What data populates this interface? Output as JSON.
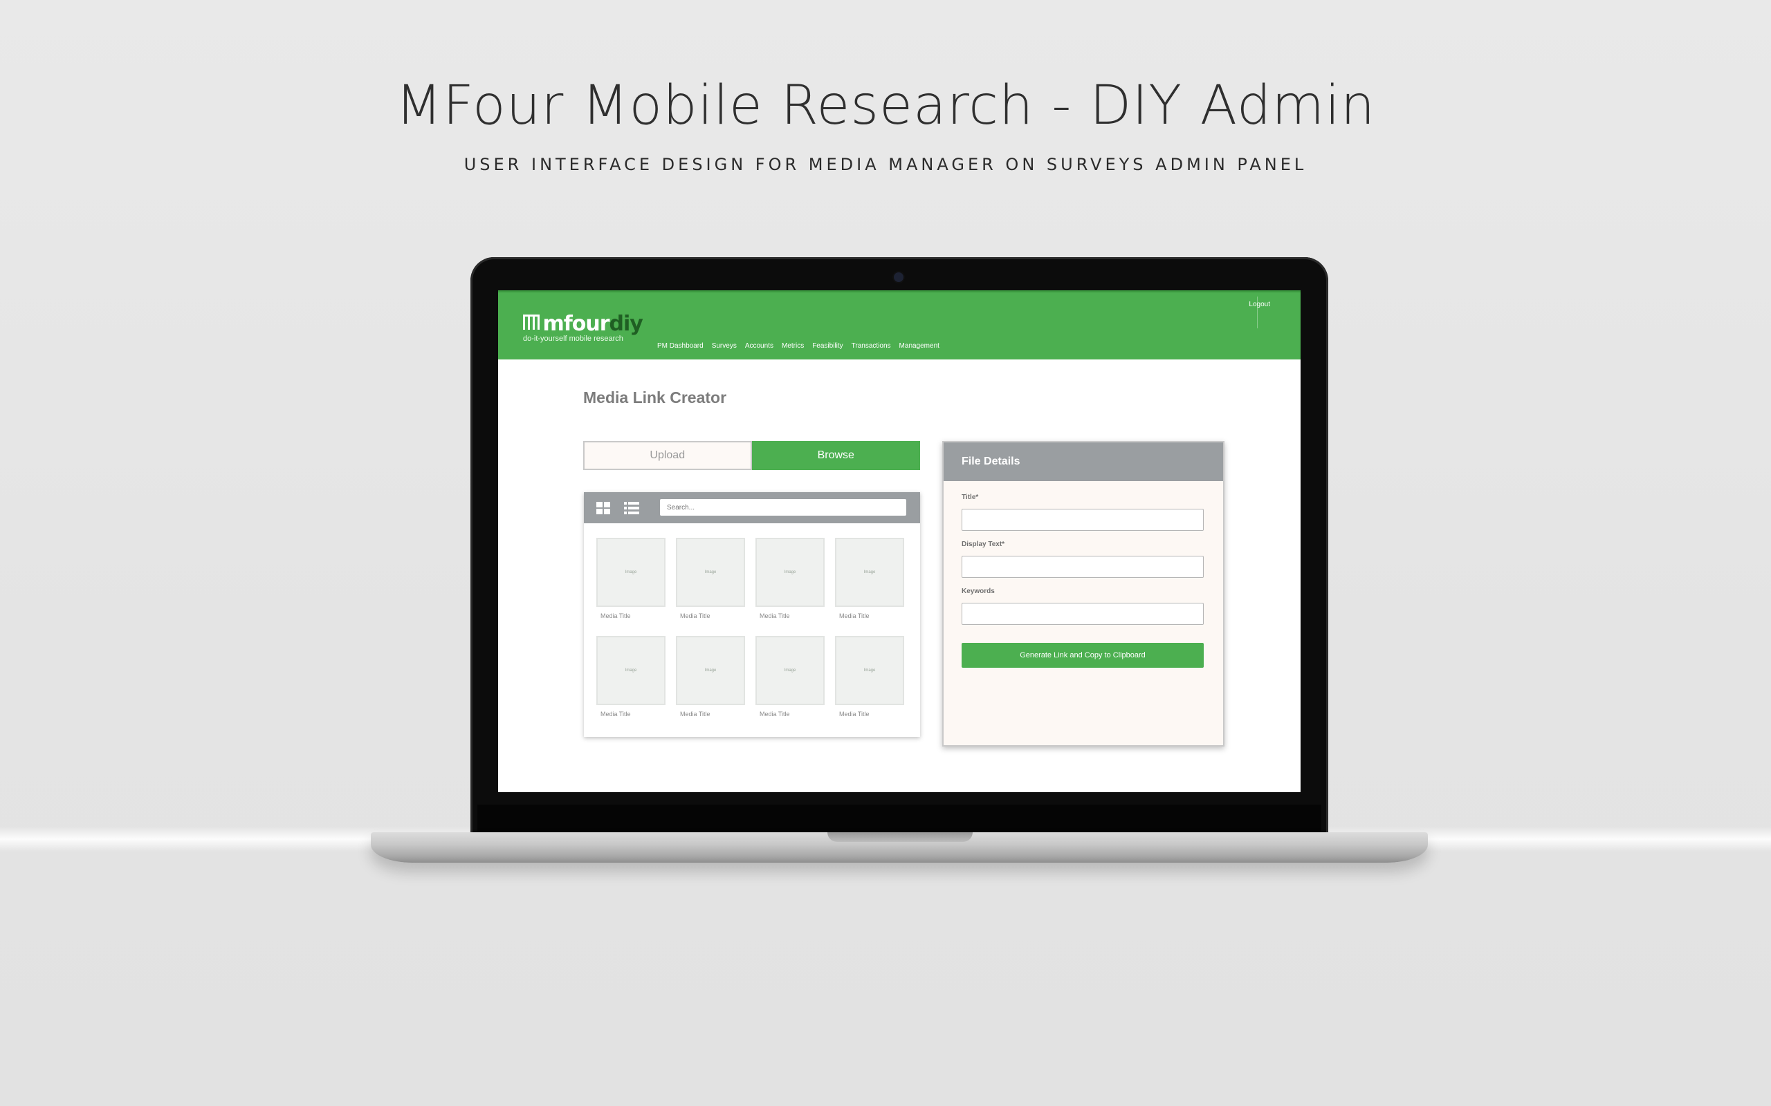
{
  "showcase": {
    "title": "MFour Mobile Research - DIY Admin",
    "subtitle": "USER INTERFACE DESIGN FOR MEDIA MANAGER ON SURVEYS ADMIN PANEL"
  },
  "app": {
    "logo_main": "mfour",
    "logo_accent": "diy",
    "logo_tagline": "do-it-yourself mobile research",
    "logout_label": "Logout",
    "nav": [
      "PM Dashboard",
      "Surveys",
      "Accounts",
      "Metrics",
      "Feasibility",
      "Transactions",
      "Management"
    ],
    "colors": {
      "brand_green": "#4caf50",
      "panel_gray": "#9a9ea1"
    }
  },
  "main": {
    "page_title": "Media Link Creator",
    "tabs": [
      {
        "label": "Upload",
        "active": false
      },
      {
        "label": "Browse",
        "active": true
      }
    ],
    "browser": {
      "grid_view_icon": "grid-view-icon",
      "list_view_icon": "list-view-icon",
      "search_placeholder": "Search...",
      "items": [
        {
          "thumb_label": "Image",
          "title": "Media Title"
        },
        {
          "thumb_label": "Image",
          "title": "Media Title"
        },
        {
          "thumb_label": "Image",
          "title": "Media Title"
        },
        {
          "thumb_label": "Image",
          "title": "Media Title"
        },
        {
          "thumb_label": "Image",
          "title": "Media Title"
        },
        {
          "thumb_label": "Image",
          "title": "Media Title"
        },
        {
          "thumb_label": "Image",
          "title": "Media Title"
        },
        {
          "thumb_label": "Image",
          "title": "Media Title"
        }
      ]
    },
    "details": {
      "header": "File Details",
      "title_label": "Title*",
      "title_value": "",
      "display_text_label": "Display Text*",
      "display_text_value": "",
      "keywords_label": "Keywords",
      "keywords_value": "",
      "generate_button": "Generate Link and Copy to Clipboard"
    }
  }
}
